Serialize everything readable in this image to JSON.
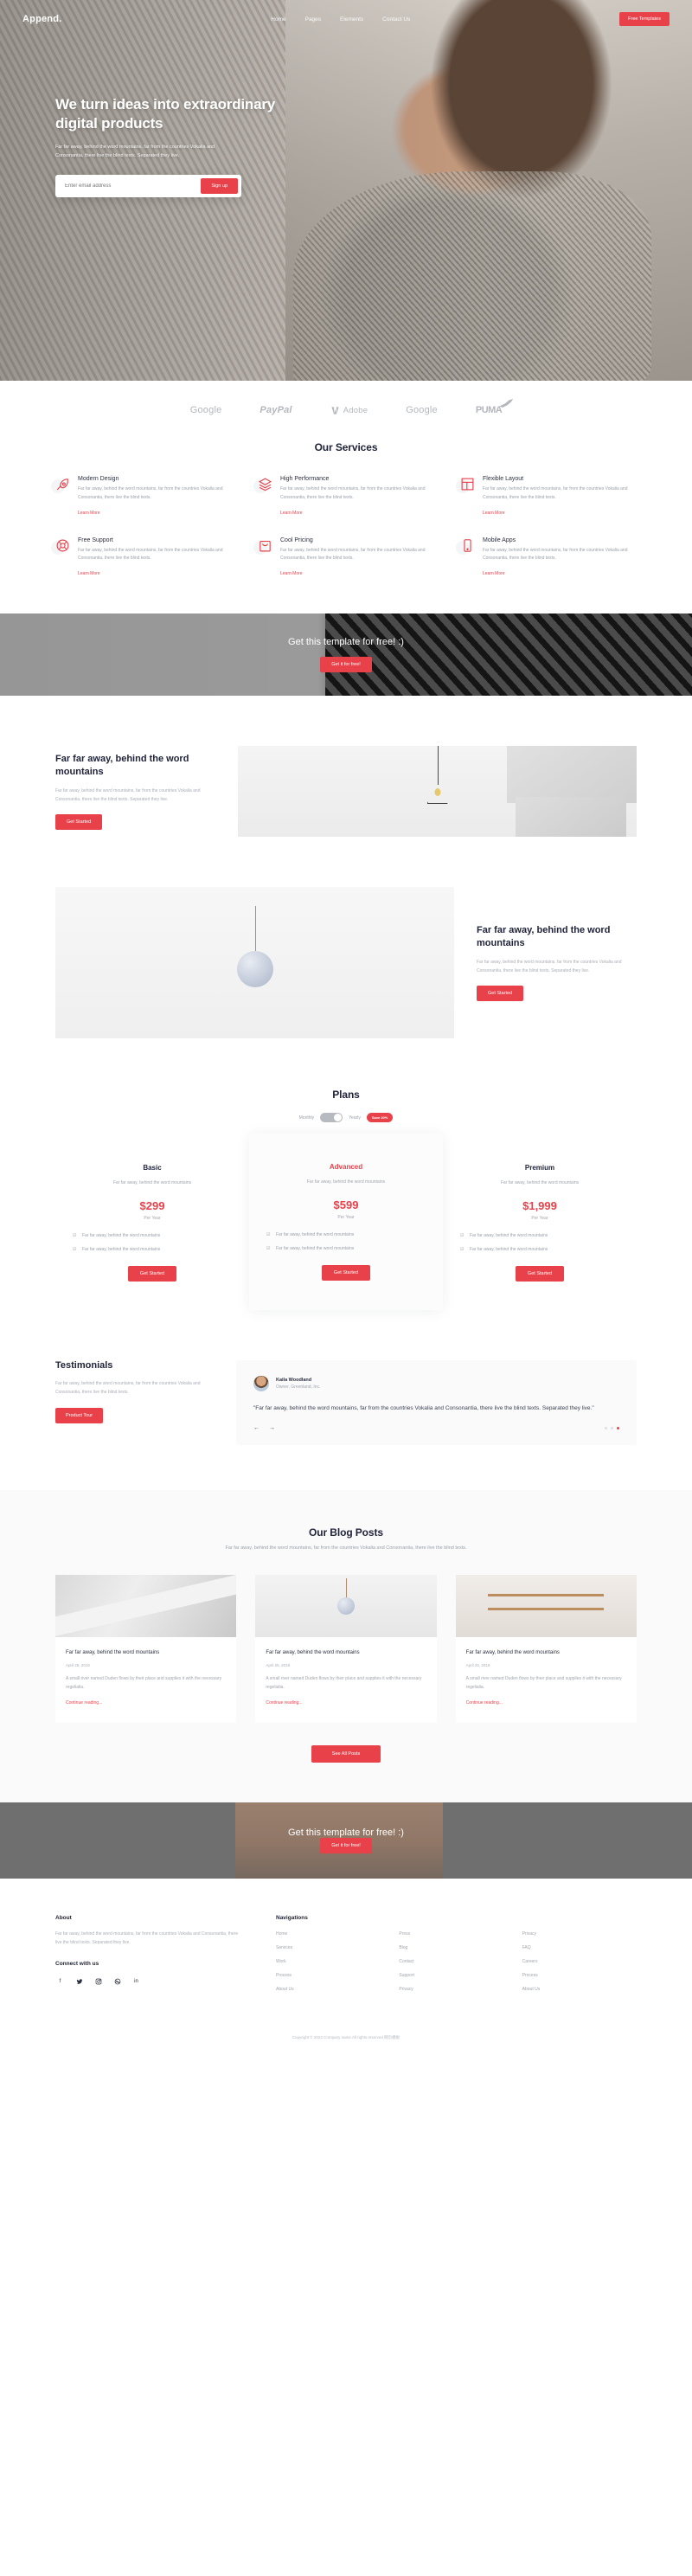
{
  "header": {
    "brand": "Append.",
    "nav": [
      {
        "label": "Home"
      },
      {
        "label": "Pages"
      },
      {
        "label": "Elements"
      },
      {
        "label": "Contact Us"
      }
    ],
    "cta_label": "Free Templates"
  },
  "hero": {
    "heading": "We turn ideas into extraordinary digital products",
    "paragraph": "Far far away, behind the word mountains, far from the countries Vokalia and Consonantia, there live the blind texts. Separated they live.",
    "email_placeholder": "Enter email address",
    "email_value": "",
    "signup_label": "Sign up"
  },
  "logos": [
    {
      "name": "Google"
    },
    {
      "name": "PayPal"
    },
    {
      "name": "Adobe"
    },
    {
      "name": "Google"
    },
    {
      "name": "PUMA"
    }
  ],
  "services": {
    "title": "Our Services",
    "items": [
      {
        "icon": "pen-nib-icon",
        "title": "Modern Design",
        "text": "Far far away, behind the word mountains, far from the countries Vokalia and Consonantia, there live the blind texts.",
        "link": "Learn More"
      },
      {
        "icon": "layers-icon",
        "title": "High Performance",
        "text": "Far far away, behind the word mountains, far from the countries Vokalia and Consonantia, there live the blind texts.",
        "link": "Learn More"
      },
      {
        "icon": "layout-grid-icon",
        "title": "Flexible Layout",
        "text": "Far far away, behind the word mountains, far from the countries Vokalia and Consonantia, there live the blind texts.",
        "link": "Learn More"
      },
      {
        "icon": "lifebuoy-icon",
        "title": "Free Support",
        "text": "Far far away, behind the word mountains, far from the countries Vokalia and Consonantia, there live the blind texts.",
        "link": "Learn More"
      },
      {
        "icon": "shopping-bag-icon",
        "title": "Cool Pricing",
        "text": "Far far away, behind the word mountains, far from the countries Vokalia and Consonantia, there live the blind texts.",
        "link": "Learn More"
      },
      {
        "icon": "mobile-phone-icon",
        "title": "Mobile Apps",
        "text": "Far far away, behind the word mountains, far from the countries Vokalia and Consonantia, there live the blind texts.",
        "link": "Learn More"
      }
    ]
  },
  "cta_band": {
    "title": "Get this template for free! :)",
    "button": "Get it for free!"
  },
  "feature_one": {
    "heading": "Far far away, behind the word mountains",
    "paragraph": "Far far away, behind the word mountains, far from the countries Vokalia and Consonantia, there live the blind texts. Separated they live.",
    "button": "Get Started"
  },
  "feature_two": {
    "heading": "Far far away, behind the word mountains",
    "paragraph": "Far far away, behind the word mountains, far from the countries Vokalia and Consonantia, there live the blind texts. Separated they live.",
    "button": "Get Started"
  },
  "plans": {
    "title": "Plans",
    "toggle": {
      "monthly_label": "Monthly",
      "yearly_label": "Yearly",
      "badge": "Save 20%",
      "selected": "Yearly"
    },
    "items": [
      {
        "name": "Basic",
        "desc": "Far far away, behind the word mountains",
        "price": "$299",
        "period": "Per Year",
        "features": [
          "Far far away, behind the word mountains",
          "Far far away, behind the word mountains"
        ],
        "button": "Get Started",
        "featured": false
      },
      {
        "name": "Advanced",
        "desc": "Far far away, behind the word mountains",
        "price": "$599",
        "period": "Per Year",
        "features": [
          "Far far away, behind the word mountains",
          "Far far away, behind the word mountains"
        ],
        "button": "Get Started",
        "featured": true
      },
      {
        "name": "Premium",
        "desc": "Far far away, behind the word mountains",
        "price": "$1,999",
        "period": "Per Year",
        "features": [
          "Far far away, behind the word mountains",
          "Far far away, behind the word mountains"
        ],
        "button": "Get Started",
        "featured": false
      }
    ]
  },
  "testimonials": {
    "title": "Testimonials",
    "paragraph": "Far far away, behind the word mountains, far from the countries Vokalia and Consonantia, there live the blind texts.",
    "button": "Product Tour",
    "card": {
      "name": "Kaila Woodland",
      "role": "Owner, Greenland, Inc.",
      "quote": "\"Far far away, behind the word mountains, far from the countries Vokalia and Consonantia, there live the blind texts. Separated they live.\"",
      "prev_icon": "arrow-left-icon",
      "next_icon": "arrow-right-icon",
      "dots": 3,
      "active_dot": 3
    }
  },
  "blog": {
    "title": "Our Blog Posts",
    "subtitle": "Far far away, behind the word mountains, far from the countries Vokalia and Consonantia, there live the blind texts.",
    "posts": [
      {
        "title": "Far far away, behind the word mountains",
        "date": "April 25, 2019",
        "excerpt": "A small river named Duden flows by their place and supplies it with the necessary regelialia.",
        "more": "Continue reading..."
      },
      {
        "title": "Far far away, behind the word mountains",
        "date": "April 25, 2019",
        "excerpt": "A small river named Duden flows by their place and supplies it with the necessary regelialia.",
        "more": "Continue reading..."
      },
      {
        "title": "Far far away, behind the word mountains",
        "date": "April 25, 2019",
        "excerpt": "A small river named Duden flows by their place and supplies it with the necessary regelialia.",
        "more": "Continue reading..."
      }
    ],
    "see_all": "See All Posts"
  },
  "cta_bottom": {
    "title": "Get this template for free! :)",
    "button": "Get it for free!"
  },
  "footer": {
    "about_heading": "About",
    "about_text": "Far far away, behind the word mountains, far from the countries Vokalia and Consonantia, there live the blind texts. Separated they live.",
    "connect_heading": "Connect with us",
    "socials": [
      {
        "icon": "facebook-icon",
        "glyph": "f"
      },
      {
        "icon": "twitter-icon",
        "glyph": "ᵛ"
      },
      {
        "icon": "instagram-icon",
        "glyph": "◎"
      },
      {
        "icon": "dribbble-icon",
        "glyph": "○"
      },
      {
        "icon": "linkedin-icon",
        "glyph": "in"
      }
    ],
    "nav_heading": "Navigations",
    "columns": [
      [
        "Home",
        "Services",
        "Work",
        "Process",
        "About Us"
      ],
      [
        "Press",
        "Blog",
        "Contact",
        "Support",
        "Privacy"
      ],
      [
        "Privacy",
        "FAQ",
        "Careers",
        "Process",
        "About Us"
      ]
    ],
    "copyright": "Copyright © 2022 Company name All rights reserved 网页模板"
  },
  "colors": {
    "accent": "#e8414a",
    "dark": "#20243a",
    "muted": "#a0a5ad"
  }
}
